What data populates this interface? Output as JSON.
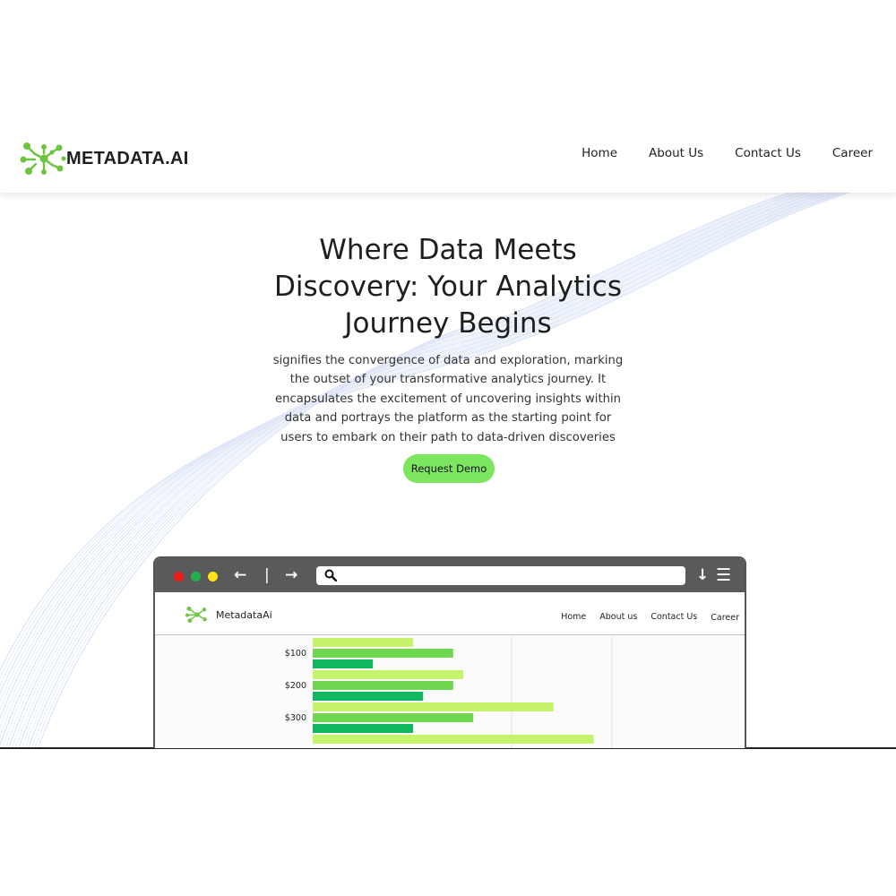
{
  "site": {
    "brand": "METADATA.AI",
    "nav": [
      "Home",
      "About Us",
      "Contact Us",
      "Career"
    ]
  },
  "hero": {
    "title": "Where Data Meets Discovery: Your Analytics Journey Begins",
    "description": "signifies the convergence of data and exploration, marking the outset of your transformative analytics journey. It encapsulates the excitement of uncovering insights within data and portrays the platform as the starting point for users to embark on their path to data-driven discoveries",
    "cta": "Request Demo"
  },
  "mockup": {
    "brand": "MetadataAi",
    "nav": [
      "Home",
      "About us",
      "Contact Us",
      "Career"
    ]
  },
  "colors": {
    "accent": "#7ce661",
    "bar_light": "#c5f46c",
    "bar_mid": "#6fd64f",
    "bar_dark": "#0fb85f",
    "browser_chrome": "#5a5a5a",
    "dot_red": "#ef1b1b",
    "dot_green": "#22b14c",
    "dot_yellow": "#ffe21a"
  },
  "icons": [
    "logo-molecule-icon",
    "back-arrow-icon",
    "separator-icon",
    "forward-arrow-icon",
    "search-icon",
    "download-icon",
    "menu-icon"
  ],
  "chart_data": {
    "type": "bar",
    "orientation": "horizontal",
    "categories": [
      "$100",
      "$200",
      "$300"
    ],
    "series": [
      {
        "values": [
          50,
          75,
          120
        ]
      },
      {
        "values": [
          70,
          70,
          80
        ]
      },
      {
        "values": [
          30,
          55,
          50
        ]
      }
    ],
    "partially_visible_next_bar": 140,
    "grid": true
  }
}
